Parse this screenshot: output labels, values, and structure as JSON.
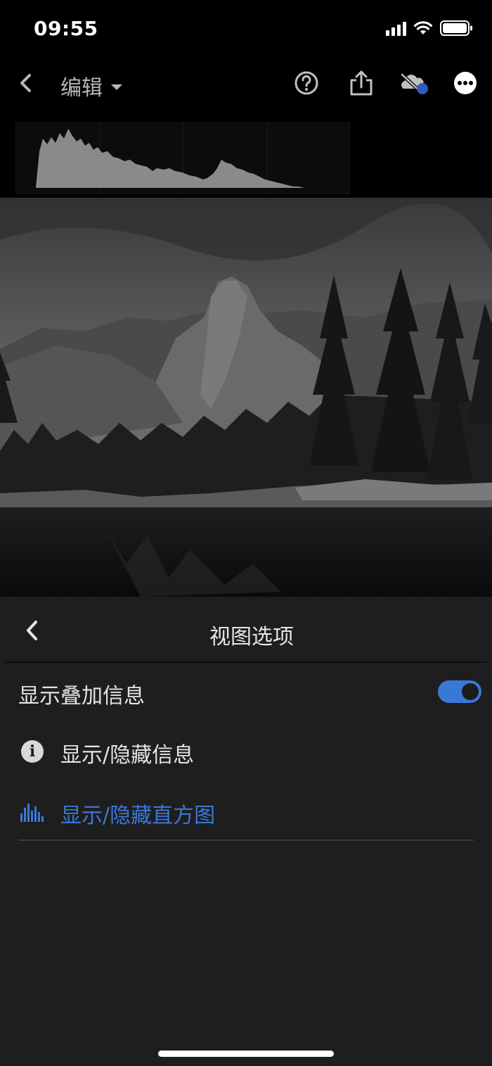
{
  "status_bar": {
    "time": "09:55"
  },
  "toolbar": {
    "title": "编辑"
  },
  "panel": {
    "title": "视图选项",
    "overlay_label": "显示叠加信息",
    "overlay_enabled": true,
    "info_row_label": "显示/隐藏信息",
    "histogram_row_label": "显示/隐藏直方图"
  },
  "colors": {
    "accent": "#3a78d8",
    "panel_bg": "#1e1e1e"
  },
  "icons": [
    "back-chevron-icon",
    "dropdown-caret-icon",
    "help-icon",
    "share-icon",
    "cloud-off-icon",
    "more-icon",
    "info-icon",
    "histogram-icon"
  ]
}
